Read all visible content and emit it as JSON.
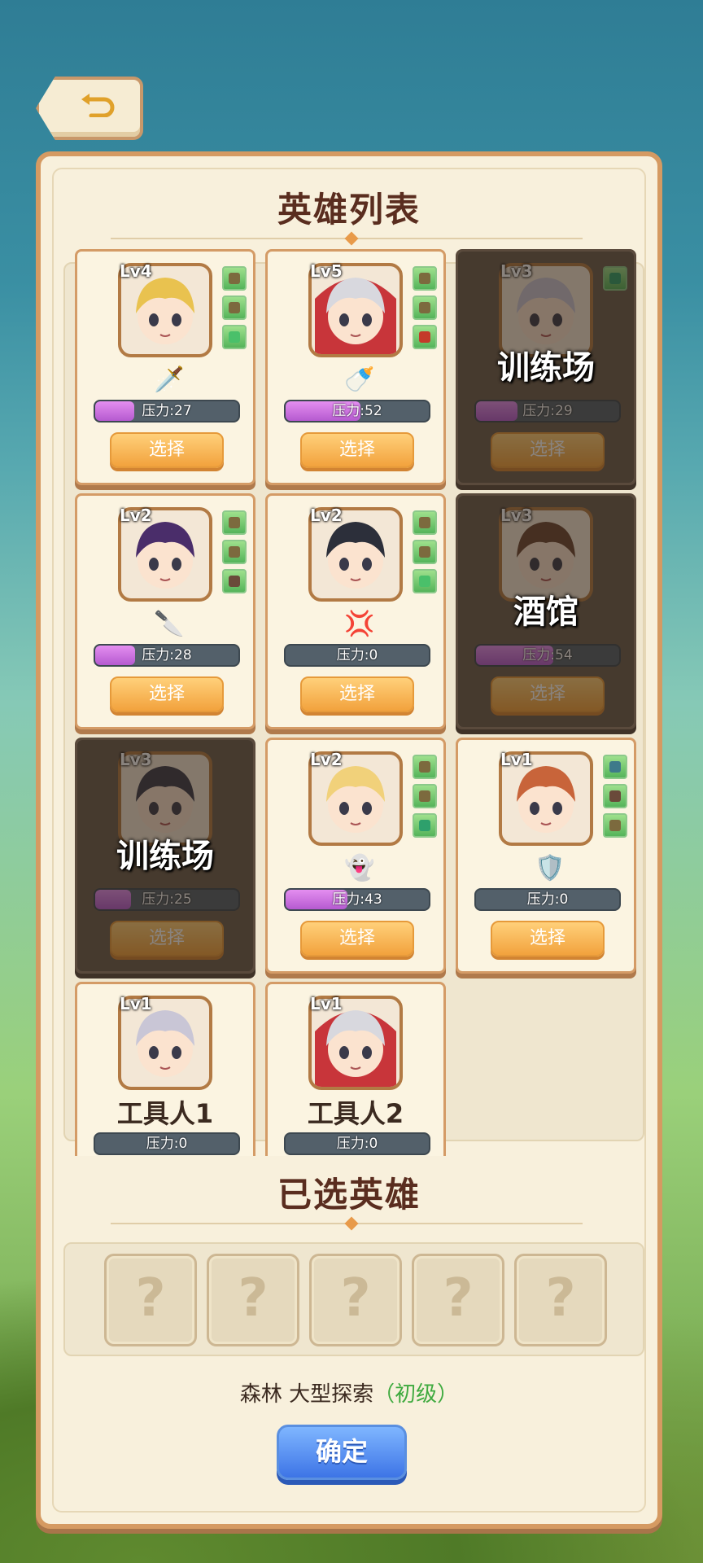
{
  "back_button": {
    "icon": "back-arrow-icon"
  },
  "hero_list": {
    "title": "英雄列表"
  },
  "selected": {
    "title": "已选英雄",
    "slots": [
      "?",
      "?",
      "?",
      "?",
      "?"
    ]
  },
  "mission": {
    "name": "森林 大型探索",
    "level": "（初级）"
  },
  "confirm_label": "确定",
  "select_label": "选择",
  "heroes": [
    {
      "level": "Lv4",
      "stress": "压力:27",
      "stress_value": 27,
      "items": [
        "bag-icon",
        "bag-icon",
        "wing-icon"
      ],
      "trait": "🗡️",
      "disabled": false,
      "hair": "#e9c24f",
      "hood": ""
    },
    {
      "level": "Lv5",
      "stress": "压力:52",
      "stress_value": 52,
      "items": [
        "bag-icon",
        "bag-icon",
        "axe-icon"
      ],
      "trait": "🍼",
      "disabled": false,
      "hair": "#d8d8de",
      "hood": "#c8353a"
    },
    {
      "level": "Lv3",
      "stress": "压力:29",
      "stress_value": 29,
      "items": [
        "swirl-icon"
      ],
      "trait": "",
      "disabled": true,
      "lock": "训练场",
      "hair": "#c9c6d6",
      "hood": ""
    },
    {
      "level": "Lv2",
      "stress": "压力:28",
      "stress_value": 28,
      "items": [
        "bag-icon",
        "bag-icon",
        "armor-icon"
      ],
      "trait": "🔪",
      "disabled": false,
      "hair": "#4a2d6a",
      "hood": ""
    },
    {
      "level": "Lv2",
      "stress": "压力:0",
      "stress_value": 0,
      "items": [
        "bag-icon",
        "bag-icon",
        "wing-icon"
      ],
      "trait": "💢",
      "disabled": false,
      "hair": "#2c2f3a",
      "hood": ""
    },
    {
      "level": "Lv3",
      "stress": "压力:54",
      "stress_value": 54,
      "items": [],
      "trait": "",
      "disabled": true,
      "lock": "酒馆",
      "hair": "#6a4632",
      "hood": ""
    },
    {
      "level": "Lv3",
      "stress": "压力:25",
      "stress_value": 25,
      "items": [],
      "trait": "",
      "disabled": true,
      "lock": "训练场",
      "hair": "#3a3a4a",
      "hood": ""
    },
    {
      "level": "Lv2",
      "stress": "压力:43",
      "stress_value": 43,
      "items": [
        "bag-icon",
        "bag-icon",
        "swirl-icon"
      ],
      "trait": "👻",
      "disabled": false,
      "hair": "#f1d17a",
      "hood": ""
    },
    {
      "level": "Lv1",
      "stress": "压力:0",
      "stress_value": 0,
      "items": [
        "helmet-icon",
        "armor-icon",
        "bag-icon"
      ],
      "trait": "🛡️",
      "disabled": false,
      "hair": "#c8643a",
      "hood": ""
    },
    {
      "level": "Lv1",
      "stress": "压力:0",
      "stress_value": 0,
      "items": [],
      "trait": "",
      "disabled": false,
      "name": "工具人1",
      "hair": "#c9c6d6",
      "hood": ""
    },
    {
      "level": "Lv1",
      "stress": "压力:0",
      "stress_value": 0,
      "items": [],
      "trait": "",
      "disabled": false,
      "name": "工具人2",
      "hair": "#d8d8de",
      "hood": "#c8353a"
    }
  ]
}
